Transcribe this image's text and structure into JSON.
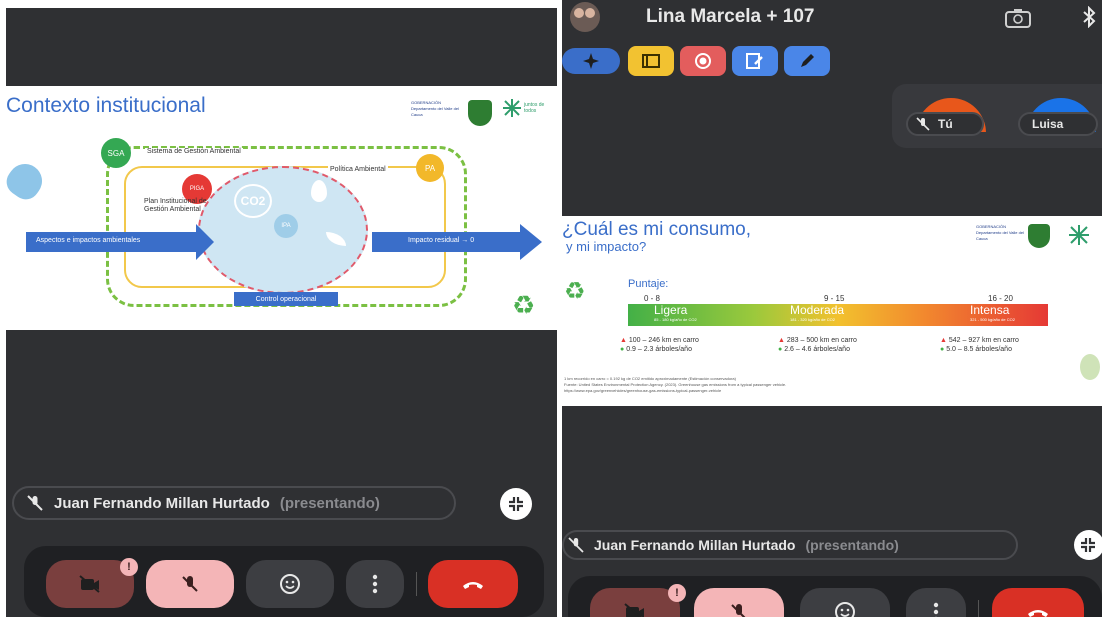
{
  "left": {
    "slide": {
      "title": "Contexto institucional",
      "logo_text": "GOBERNACIÓN Departamento del Valle del Cauca",
      "logo2_text": "juntos de todos",
      "sga_badge": "SGA",
      "sga_label": "Sistema de Gestión Ambiental",
      "pa_label": "Política Ambiental",
      "pa_badge": "PA",
      "pigs_badge": "PIGA",
      "plan_label": "Plan Institucional de Gestión Ambiental",
      "co2": "CO2",
      "ipa": "IPA",
      "left_arrow": "Aspectos e impactos ambientales",
      "right_arrow": "Impacto residual → 0",
      "control": "Control operacional"
    },
    "presenter": {
      "name": "Juan Fernando Millan Hurtado",
      "suffix": "(presentando)"
    },
    "controls": {
      "alert": "!"
    }
  },
  "right": {
    "header": {
      "title": "Lina Marcela + 107"
    },
    "participants": [
      {
        "name": "Tú"
      },
      {
        "name": "Luisa"
      }
    ],
    "slide": {
      "title_line1": "¿Cuál es mi consumo,",
      "title_line2": "y mi impacto?",
      "puntaje": "Puntaje:",
      "ranges": [
        "0 - 8",
        "9 - 15",
        "16 - 20"
      ],
      "levels": [
        "Ligera",
        "Moderada",
        "Intensa"
      ],
      "level_sub": [
        "85 - 180 kg/año de CO2",
        "181 - 320 kg/año de CO2",
        "321 - 500 kg/año de CO2"
      ],
      "km": [
        "100 – 246 km en carro",
        "283 – 500 km en carro",
        "542 – 927 km en carro"
      ],
      "trees": [
        "0.9 – 2.3 árboles/año",
        "2.6 – 4.6 árboles/año",
        "5.0 – 8.5 árboles/año"
      ],
      "note1": "1 km recorrido en carro = 0.192 kg de CO2 emitido aproximadamente (Estimación conservadora)",
      "note2": "Fuente: United States Environmental Protection Agency. (2023). Greenhouse gas emissions from a typical passenger vehicle.",
      "note3": "https://www.epa.gov/greenvehicles/greenhouse-gas-emissions-typical-passenger-vehicle"
    },
    "presenter": {
      "name": "Juan Fernando Millan Hurtado",
      "suffix": "(presentando)"
    },
    "controls": {
      "alert": "!"
    }
  },
  "colors": {
    "bg": "#2f3033",
    "hangup": "#d93025",
    "mic_off": "#f4b5b7",
    "cam_off": "#7a3f3e",
    "blue": "#3a6ec9",
    "green_badge": "#34a853",
    "yellow_badge": "#f2b82a"
  }
}
